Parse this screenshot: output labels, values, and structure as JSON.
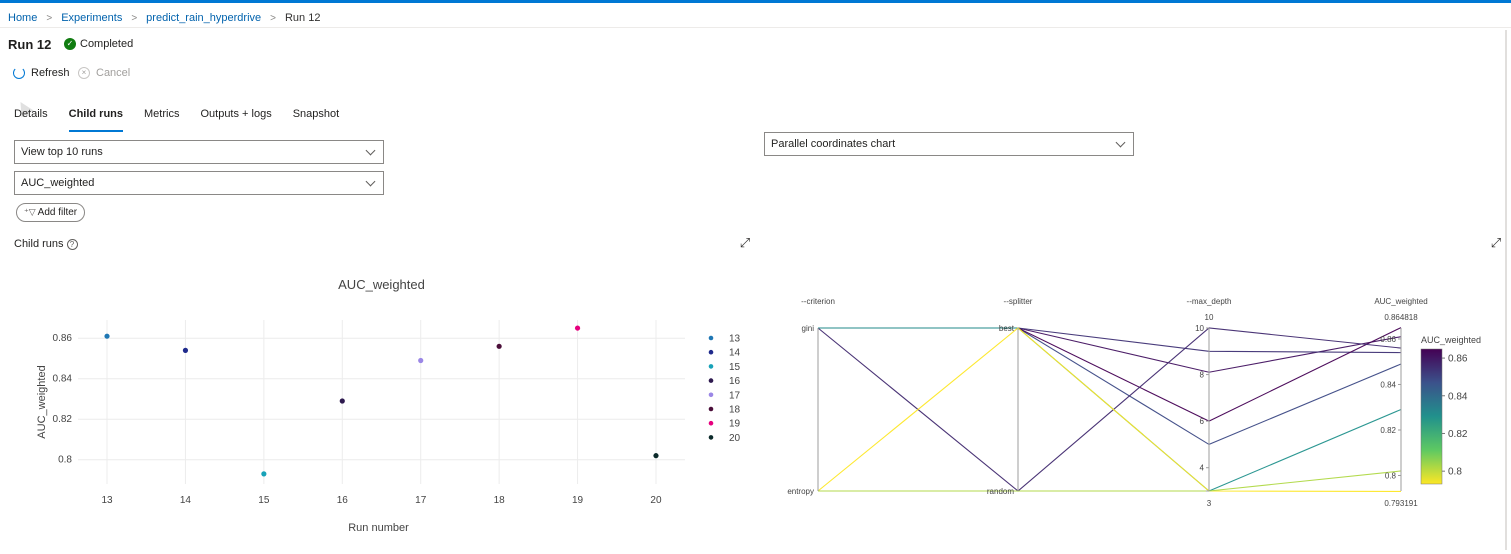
{
  "breadcrumb": {
    "items": [
      "Home",
      "Experiments",
      "predict_rain_hyperdrive"
    ],
    "current": "Run 12"
  },
  "run": {
    "title": "Run 12",
    "status": "Completed"
  },
  "commands": {
    "refresh": "Refresh",
    "cancel": "Cancel"
  },
  "tabs": [
    "Details",
    "Child runs",
    "Metrics",
    "Outputs + logs",
    "Snapshot"
  ],
  "active_tab": "Child runs",
  "filters": {
    "view_runs": "View top 10 runs",
    "metric": "AUC_weighted",
    "add_filter": "Add filter",
    "chart_type": "Parallel coordinates chart"
  },
  "section_label": "Child runs",
  "colors": {
    "accent": "#0078d4",
    "success": "#107c10",
    "link": "#0062ad"
  },
  "chart_data": [
    {
      "type": "scatter",
      "title": "AUC_weighted",
      "xlabel": "Run number",
      "ylabel": "AUC_weighted",
      "x": [
        13,
        14,
        15,
        16,
        17,
        18,
        19,
        20
      ],
      "xticks": [
        13,
        14,
        15,
        16,
        17,
        18,
        19,
        20
      ],
      "yticks": [
        0.8,
        0.82,
        0.84,
        0.86
      ],
      "ylim": [
        0.788,
        0.869
      ],
      "grid": true,
      "legend": "right",
      "series": [
        {
          "name": "13",
          "x": 13,
          "y": 0.861,
          "color": "#1f77b4"
        },
        {
          "name": "14",
          "x": 14,
          "y": 0.854,
          "color": "#1f2a8c"
        },
        {
          "name": "15",
          "x": 15,
          "y": 0.793,
          "color": "#17a2b8"
        },
        {
          "name": "16",
          "x": 16,
          "y": 0.829,
          "color": "#2e1a4f"
        },
        {
          "name": "17",
          "x": 17,
          "y": 0.849,
          "color": "#9b87e6"
        },
        {
          "name": "18",
          "x": 18,
          "y": 0.856,
          "color": "#4b0f3a"
        },
        {
          "name": "19",
          "x": 19,
          "y": 0.865,
          "color": "#e6007e"
        },
        {
          "name": "20",
          "x": 20,
          "y": 0.802,
          "color": "#0b2a2a"
        }
      ]
    },
    {
      "type": "parallel_coordinates",
      "dimensions": [
        {
          "label": "--criterion",
          "ticks": [
            "gini",
            "entropy"
          ]
        },
        {
          "label": "--splitter",
          "ticks": [
            "best",
            "random"
          ]
        },
        {
          "label": "--max_depth",
          "range": [
            3,
            10
          ],
          "ticks": [
            3,
            4,
            6,
            8,
            10
          ]
        },
        {
          "label": "AUC_weighted",
          "range": [
            0.793191,
            0.864818
          ],
          "range_labels": [
            "0.793191",
            "0.864818"
          ],
          "ticks": [
            0.8,
            0.82,
            0.84,
            0.86
          ]
        }
      ],
      "colorbar": {
        "title": "AUC_weighted",
        "ticks": [
          0.8,
          0.82,
          0.84,
          0.86
        ],
        "range": [
          0.793191,
          0.864818
        ]
      },
      "lines": [
        {
          "criterion": "gini",
          "splitter": "best",
          "max_depth": 8.1,
          "auc": 0.861
        },
        {
          "criterion": "gini",
          "splitter": "best",
          "max_depth": 9,
          "auc": 0.854
        },
        {
          "criterion": "gini",
          "splitter": "best",
          "max_depth": 5,
          "auc": 0.849
        },
        {
          "criterion": "gini",
          "splitter": "best",
          "max_depth": 6,
          "auc": 0.865
        },
        {
          "criterion": "gini",
          "splitter": "random",
          "max_depth": 10,
          "auc": 0.856
        },
        {
          "criterion": "gini",
          "splitter": "best",
          "max_depth": 3,
          "auc": 0.829
        },
        {
          "criterion": "entropy",
          "splitter": "best",
          "max_depth": 3,
          "auc": 0.793
        },
        {
          "criterion": "entropy",
          "splitter": "random",
          "max_depth": 3,
          "auc": 0.802
        }
      ]
    }
  ]
}
